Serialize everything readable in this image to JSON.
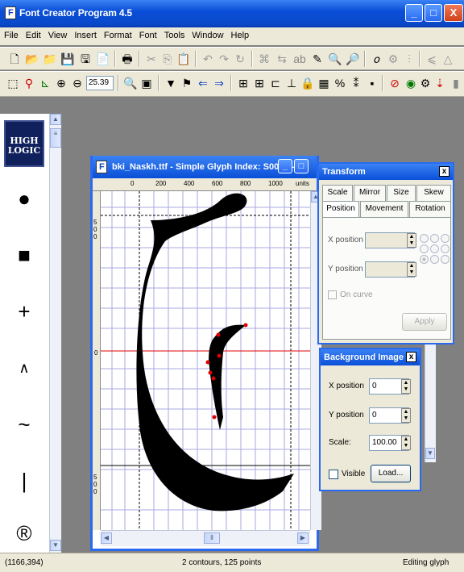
{
  "app": {
    "title": "Font Creator Program 4.5"
  },
  "menu": [
    "File",
    "Edit",
    "View",
    "Insert",
    "Format",
    "Font",
    "Tools",
    "Window",
    "Help"
  ],
  "toolbar": {
    "zoom": "25.39"
  },
  "logo": {
    "text": "HIGH LOGIC"
  },
  "tools": [
    "circle",
    "square",
    "plus",
    "caret",
    "tilde",
    "bar",
    "registered"
  ],
  "glyph_window": {
    "title": "bki_Naskh.ttf - Simple Glyph Index: S0022 - ...",
    "ruler_marks": [
      "0",
      "200",
      "400",
      "600",
      "800",
      "1000"
    ],
    "ruler_units": "units",
    "vruler": [
      "500",
      "0",
      "500"
    ]
  },
  "transform": {
    "title": "Transform",
    "tabs_row1": [
      "Scale",
      "Mirror",
      "Size",
      "Skew"
    ],
    "tabs_row2": [
      "Position",
      "Movement",
      "Rotation"
    ],
    "x_label": "X position",
    "y_label": "Y position",
    "on_curve": "On curve",
    "apply": "Apply"
  },
  "background_image": {
    "title": "Background Image",
    "x_label": "X position",
    "x_value": "0",
    "y_label": "Y position",
    "y_value": "0",
    "scale_label": "Scale:",
    "scale_value": "100.00",
    "visible_label": "Visible",
    "load": "Load..."
  },
  "status": {
    "coords": "(1166,394)",
    "points": "2 contours, 125 points",
    "mode": "Editing glyph"
  },
  "colors": {
    "accent": "#0a4fd8",
    "grid": "#9090d0",
    "baseline": "#e00000",
    "point": "#e00000"
  }
}
